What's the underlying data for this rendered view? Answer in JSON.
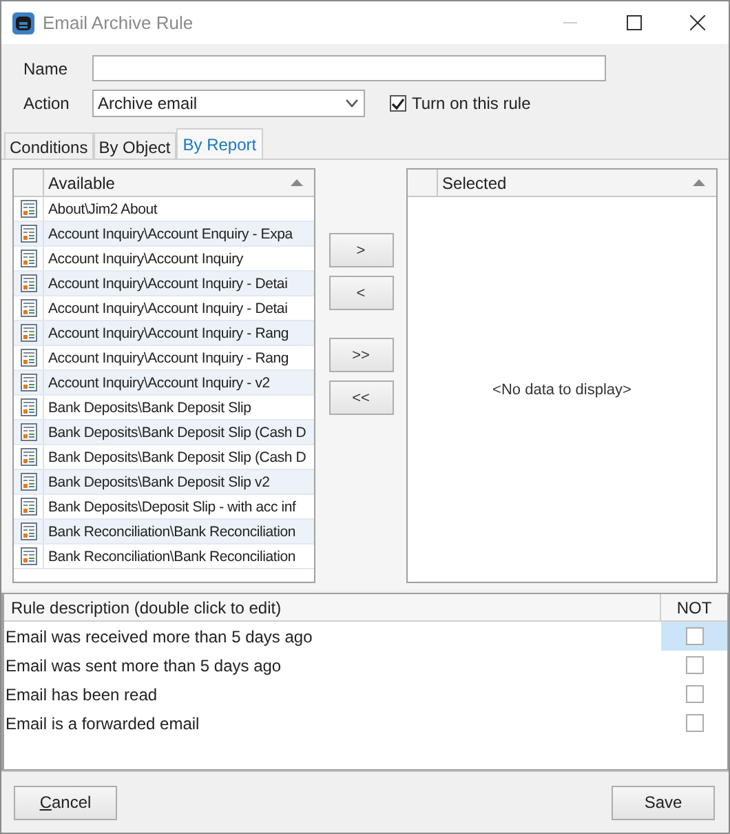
{
  "window": {
    "title": "Email Archive Rule"
  },
  "form": {
    "name_label": "Name",
    "action_label": "Action",
    "action_value": "Archive email",
    "turn_on": {
      "label": "Turn on this rule",
      "checked": true
    }
  },
  "tabs": [
    {
      "label": "Conditions",
      "selected": false
    },
    {
      "label": "By Object",
      "selected": false
    },
    {
      "label": "By Report",
      "selected": true
    }
  ],
  "available": {
    "column": "Available",
    "rows": [
      "About\\Jim2 About",
      "Account Inquiry\\Account Enquiry - Expa",
      "Account Inquiry\\Account Inquiry",
      "Account Inquiry\\Account Inquiry - Detai",
      "Account Inquiry\\Account Inquiry - Detai",
      "Account Inquiry\\Account Inquiry - Rang",
      "Account Inquiry\\Account Inquiry - Rang",
      "Account Inquiry\\Account Inquiry - v2",
      "Bank Deposits\\Bank Deposit Slip",
      "Bank Deposits\\Bank Deposit Slip (Cash D",
      "Bank Deposits\\Bank Deposit Slip (Cash D",
      "Bank Deposits\\Bank Deposit Slip v2",
      "Bank Deposits\\Deposit Slip - with acc inf",
      "Bank Reconciliation\\Bank Reconciliation",
      "Bank Reconciliation\\Bank Reconciliation"
    ]
  },
  "move_buttons": [
    ">",
    "<",
    ">>",
    "<<"
  ],
  "selected_list": {
    "column": "Selected",
    "empty_text": "<No data to display>"
  },
  "rules": {
    "columns": [
      "Rule description (double click to edit)",
      "NOT"
    ],
    "rows": [
      {
        "text": "Email was received more than 5 days ago",
        "not": false,
        "selected": true
      },
      {
        "text": "Email was sent more than 5 days ago",
        "not": false,
        "selected": false
      },
      {
        "text": "Email has been read",
        "not": false,
        "selected": false
      },
      {
        "text": "Email is a forwarded email",
        "not": false,
        "selected": false
      }
    ]
  },
  "buttons": {
    "cancel": "Cancel",
    "save": "Save"
  }
}
